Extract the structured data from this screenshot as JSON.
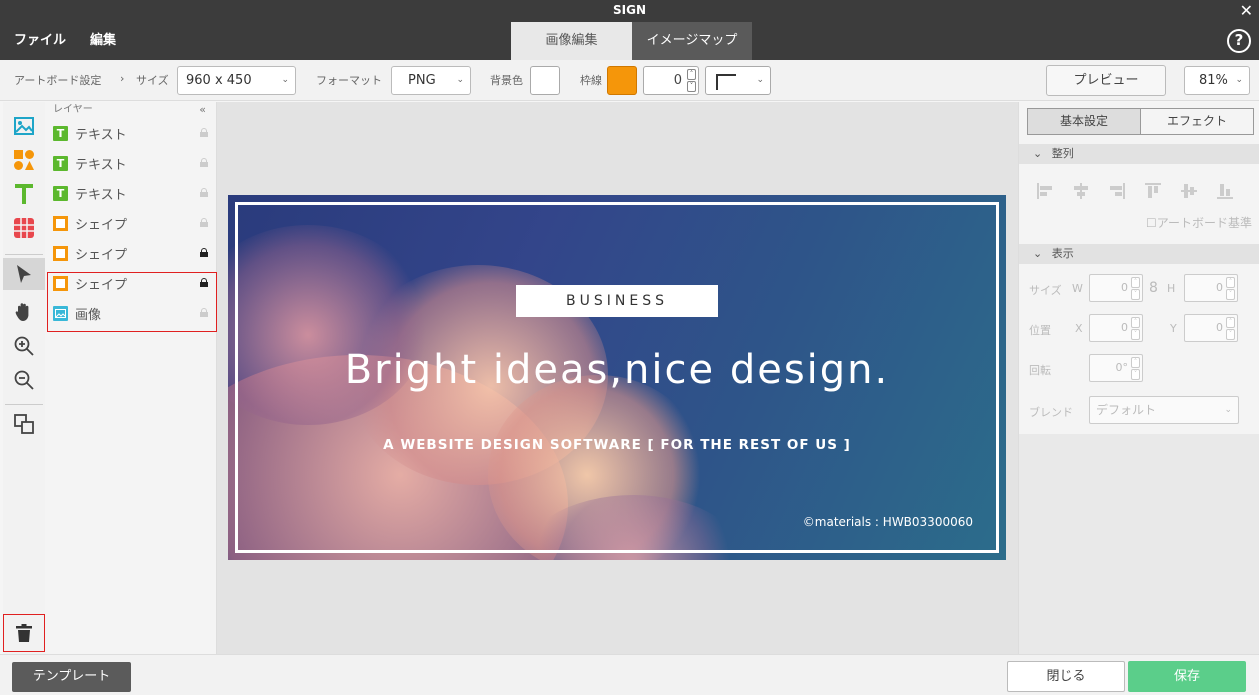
{
  "app": {
    "title": "SIGN",
    "close_glyph": "✕"
  },
  "menu": {
    "items": [
      "ファイル",
      "編集"
    ]
  },
  "mode_tabs": [
    {
      "label": "画像編集",
      "active": true
    },
    {
      "label": "イメージマップ",
      "active": false
    }
  ],
  "help": {
    "glyph": "?"
  },
  "toolbar": {
    "artboard_settings": "アートボード設定",
    "separator": "›",
    "size_label": "サイズ",
    "size_value": "960 x 450",
    "format_label": "フォーマット",
    "format_value": "PNG",
    "bg_color_label": "背景色",
    "bg_color": "#ffffff",
    "border_label": "枠線",
    "border_color": "#f5960a",
    "border_width": "0",
    "preview_label": "プレビュー",
    "zoom_value": "81%"
  },
  "tools": {
    "icons": [
      "image-icon",
      "shapes-icon",
      "text-icon",
      "table-icon",
      "pointer-icon",
      "hand-icon",
      "zoom-in-icon",
      "zoom-out-icon",
      "arrange-icon",
      "trash-icon"
    ]
  },
  "layers": {
    "header": "レイヤー",
    "collapse": "«",
    "items": [
      {
        "type": "text",
        "label": "テキスト",
        "locked": false
      },
      {
        "type": "text",
        "label": "テキスト",
        "locked": false
      },
      {
        "type": "text",
        "label": "テキスト",
        "locked": false
      },
      {
        "type": "shape",
        "label": "シェイプ",
        "locked": false
      },
      {
        "type": "shape",
        "label": "シェイプ",
        "locked": true
      },
      {
        "type": "shape",
        "label": "シェイプ",
        "locked": true
      },
      {
        "type": "image",
        "label": "画像",
        "locked": false
      }
    ]
  },
  "artboard": {
    "business": "BUSINESS",
    "headline": "Bright ideas,nice design.",
    "subline": "A WEBSITE DESIGN SOFTWARE [ FOR THE REST OF US ]",
    "credit": "©materials : HWB03300060"
  },
  "props": {
    "tab_basic": "基本設定",
    "tab_effect": "エフェクト",
    "align_header": "整列",
    "artboard_basis": "アートボード基準",
    "display_header": "表示",
    "size_label": "サイズ",
    "w_label": "W",
    "w_value": "0",
    "link_glyph": "8",
    "h_label": "H",
    "h_value": "0",
    "pos_label": "位置",
    "x_label": "X",
    "x_value": "0",
    "y_label": "Y",
    "y_value": "0",
    "rotate_label": "回転",
    "rotate_value": "0°",
    "blend_label": "ブレンド",
    "blend_value": "デフォルト",
    "section_chevron": "⌄"
  },
  "bottom": {
    "template": "テンプレート",
    "close": "閉じる",
    "save": "保存"
  },
  "colors": {
    "titlebar": "#3c3c3c",
    "text_layer": "#5cb82e",
    "shape_layer": "#f5960a",
    "image_layer": "#39b8d8",
    "save": "#5bce8a",
    "highlight": "#e02020"
  }
}
